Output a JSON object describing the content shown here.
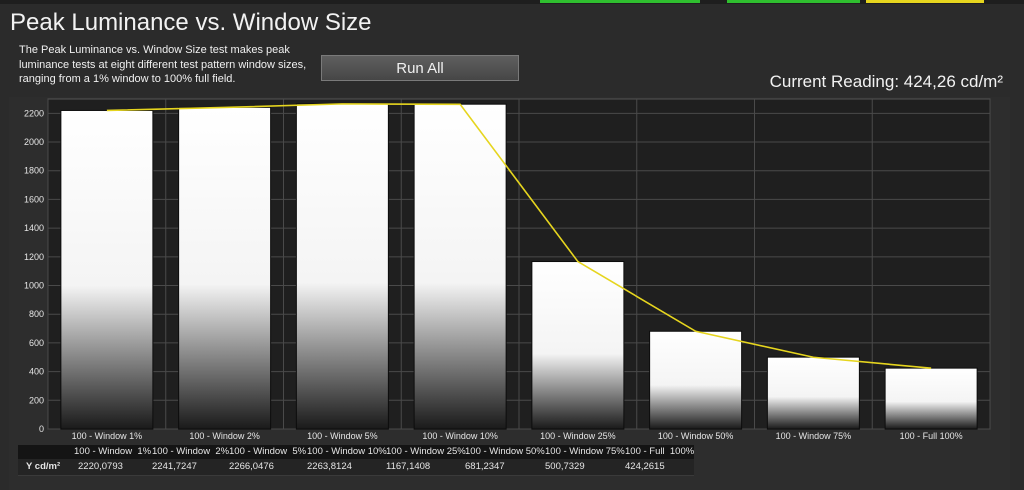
{
  "header": {
    "title": "Peak Luminance vs. Window Size",
    "description": "The Peak Luminance vs. Window Size test makes peak luminance tests at eight different test pattern window sizes, ranging from a 1% window to 100% full field.",
    "run_button_label": "Run All",
    "current_reading": "Current Reading: 424,26 cd/m²"
  },
  "colors": {
    "background": "#2b2b2b",
    "plot_background": "#1f1f1f",
    "trend_line": "#e6d51e",
    "bar_top": "#ffffff",
    "bar_bottom": "#1a1a1a",
    "top_strip_green": "#2fbf2f",
    "top_strip_yellow": "#e6d51e"
  },
  "chart_data": {
    "type": "bar",
    "categories": [
      "100 - Window  1%",
      "100 - Window  2%",
      "100 - Window  5%",
      "100 - Window 10%",
      "100 - Window 25%",
      "100 - Window 50%",
      "100 - Window 75%",
      "100 - Full  100%"
    ],
    "values": [
      2220.0793,
      2241.7247,
      2266.0476,
      2263.8124,
      1167.1408,
      681.2347,
      500.7329,
      424.2615
    ],
    "trend_line": [
      2220,
      2241,
      2266,
      2263,
      1167,
      681,
      500,
      424
    ],
    "ylim": [
      0,
      2300
    ],
    "yticks": [
      0,
      200,
      400,
      600,
      800,
      1000,
      1200,
      1400,
      1600,
      1800,
      2000,
      2200
    ],
    "grid": true
  },
  "table": {
    "row_label": "Y cd/m²",
    "headers": [
      "100 - Window  1%",
      "100 - Window  2%",
      "100 - Window  5%",
      "100 - Window 10%",
      "100 - Window 25%",
      "100 - Window 50%",
      "100 - Window 75%",
      "100 - Full  100%"
    ],
    "values": [
      "2220,0793",
      "2241,7247",
      "2266,0476",
      "2263,8124",
      "1167,1408",
      "681,2347",
      "500,7329",
      "424,2615"
    ]
  }
}
